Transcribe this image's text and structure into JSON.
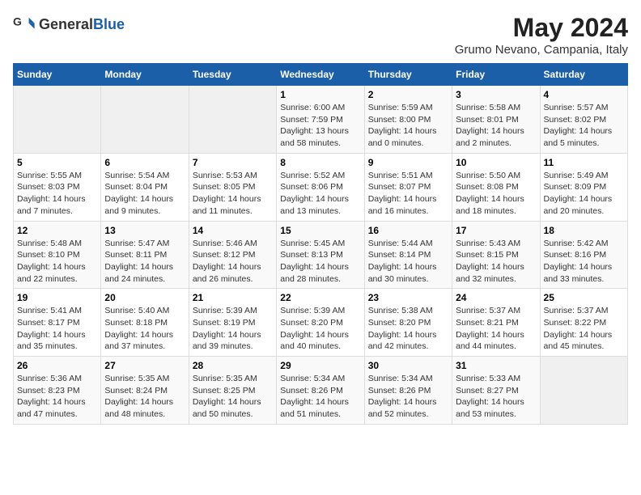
{
  "logo": {
    "text_general": "General",
    "text_blue": "Blue"
  },
  "title": "May 2024",
  "subtitle": "Grumo Nevano, Campania, Italy",
  "days_header": [
    "Sunday",
    "Monday",
    "Tuesday",
    "Wednesday",
    "Thursday",
    "Friday",
    "Saturday"
  ],
  "weeks": [
    [
      {
        "day": "",
        "info": ""
      },
      {
        "day": "",
        "info": ""
      },
      {
        "day": "",
        "info": ""
      },
      {
        "day": "1",
        "info": "Sunrise: 6:00 AM\nSunset: 7:59 PM\nDaylight: 13 hours\nand 58 minutes."
      },
      {
        "day": "2",
        "info": "Sunrise: 5:59 AM\nSunset: 8:00 PM\nDaylight: 14 hours\nand 0 minutes."
      },
      {
        "day": "3",
        "info": "Sunrise: 5:58 AM\nSunset: 8:01 PM\nDaylight: 14 hours\nand 2 minutes."
      },
      {
        "day": "4",
        "info": "Sunrise: 5:57 AM\nSunset: 8:02 PM\nDaylight: 14 hours\nand 5 minutes."
      }
    ],
    [
      {
        "day": "5",
        "info": "Sunrise: 5:55 AM\nSunset: 8:03 PM\nDaylight: 14 hours\nand 7 minutes."
      },
      {
        "day": "6",
        "info": "Sunrise: 5:54 AM\nSunset: 8:04 PM\nDaylight: 14 hours\nand 9 minutes."
      },
      {
        "day": "7",
        "info": "Sunrise: 5:53 AM\nSunset: 8:05 PM\nDaylight: 14 hours\nand 11 minutes."
      },
      {
        "day": "8",
        "info": "Sunrise: 5:52 AM\nSunset: 8:06 PM\nDaylight: 14 hours\nand 13 minutes."
      },
      {
        "day": "9",
        "info": "Sunrise: 5:51 AM\nSunset: 8:07 PM\nDaylight: 14 hours\nand 16 minutes."
      },
      {
        "day": "10",
        "info": "Sunrise: 5:50 AM\nSunset: 8:08 PM\nDaylight: 14 hours\nand 18 minutes."
      },
      {
        "day": "11",
        "info": "Sunrise: 5:49 AM\nSunset: 8:09 PM\nDaylight: 14 hours\nand 20 minutes."
      }
    ],
    [
      {
        "day": "12",
        "info": "Sunrise: 5:48 AM\nSunset: 8:10 PM\nDaylight: 14 hours\nand 22 minutes."
      },
      {
        "day": "13",
        "info": "Sunrise: 5:47 AM\nSunset: 8:11 PM\nDaylight: 14 hours\nand 24 minutes."
      },
      {
        "day": "14",
        "info": "Sunrise: 5:46 AM\nSunset: 8:12 PM\nDaylight: 14 hours\nand 26 minutes."
      },
      {
        "day": "15",
        "info": "Sunrise: 5:45 AM\nSunset: 8:13 PM\nDaylight: 14 hours\nand 28 minutes."
      },
      {
        "day": "16",
        "info": "Sunrise: 5:44 AM\nSunset: 8:14 PM\nDaylight: 14 hours\nand 30 minutes."
      },
      {
        "day": "17",
        "info": "Sunrise: 5:43 AM\nSunset: 8:15 PM\nDaylight: 14 hours\nand 32 minutes."
      },
      {
        "day": "18",
        "info": "Sunrise: 5:42 AM\nSunset: 8:16 PM\nDaylight: 14 hours\nand 33 minutes."
      }
    ],
    [
      {
        "day": "19",
        "info": "Sunrise: 5:41 AM\nSunset: 8:17 PM\nDaylight: 14 hours\nand 35 minutes."
      },
      {
        "day": "20",
        "info": "Sunrise: 5:40 AM\nSunset: 8:18 PM\nDaylight: 14 hours\nand 37 minutes."
      },
      {
        "day": "21",
        "info": "Sunrise: 5:39 AM\nSunset: 8:19 PM\nDaylight: 14 hours\nand 39 minutes."
      },
      {
        "day": "22",
        "info": "Sunrise: 5:39 AM\nSunset: 8:20 PM\nDaylight: 14 hours\nand 40 minutes."
      },
      {
        "day": "23",
        "info": "Sunrise: 5:38 AM\nSunset: 8:20 PM\nDaylight: 14 hours\nand 42 minutes."
      },
      {
        "day": "24",
        "info": "Sunrise: 5:37 AM\nSunset: 8:21 PM\nDaylight: 14 hours\nand 44 minutes."
      },
      {
        "day": "25",
        "info": "Sunrise: 5:37 AM\nSunset: 8:22 PM\nDaylight: 14 hours\nand 45 minutes."
      }
    ],
    [
      {
        "day": "26",
        "info": "Sunrise: 5:36 AM\nSunset: 8:23 PM\nDaylight: 14 hours\nand 47 minutes."
      },
      {
        "day": "27",
        "info": "Sunrise: 5:35 AM\nSunset: 8:24 PM\nDaylight: 14 hours\nand 48 minutes."
      },
      {
        "day": "28",
        "info": "Sunrise: 5:35 AM\nSunset: 8:25 PM\nDaylight: 14 hours\nand 50 minutes."
      },
      {
        "day": "29",
        "info": "Sunrise: 5:34 AM\nSunset: 8:26 PM\nDaylight: 14 hours\nand 51 minutes."
      },
      {
        "day": "30",
        "info": "Sunrise: 5:34 AM\nSunset: 8:26 PM\nDaylight: 14 hours\nand 52 minutes."
      },
      {
        "day": "31",
        "info": "Sunrise: 5:33 AM\nSunset: 8:27 PM\nDaylight: 14 hours\nand 53 minutes."
      },
      {
        "day": "",
        "info": ""
      }
    ]
  ]
}
